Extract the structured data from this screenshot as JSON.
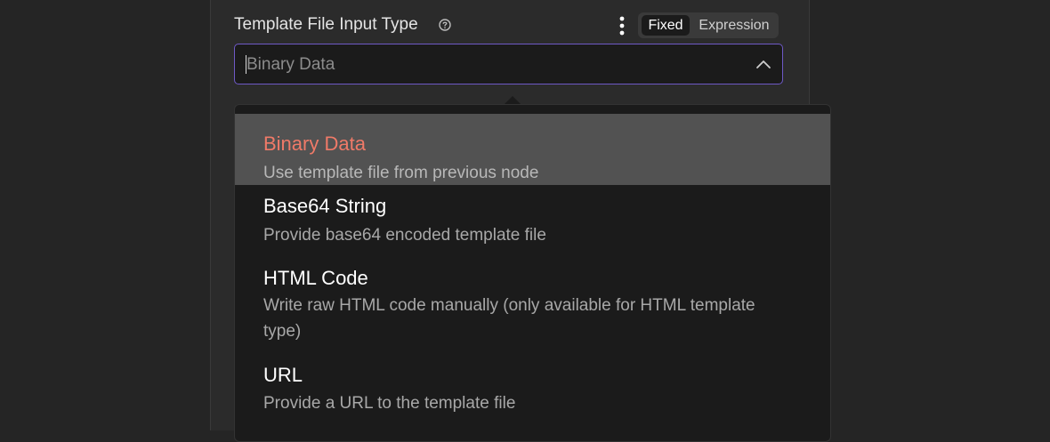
{
  "parameter": {
    "label": "Template File Input Type",
    "help_icon": "question-circle-icon",
    "options_icon": "kebab-menu-icon"
  },
  "mode_toggle": {
    "fixed_label": "Fixed",
    "expression_label": "Expression",
    "active": "Fixed"
  },
  "select": {
    "placeholder": "Binary Data",
    "chevron_icon": "chevron-up-icon"
  },
  "dropdown": {
    "items": [
      {
        "title": "Binary Data",
        "description": "Use template file from previous node",
        "selected": true
      },
      {
        "title": "Base64 String",
        "description": "Provide base64 encoded template file",
        "selected": false
      },
      {
        "title": "HTML Code",
        "description": "Write raw HTML code manually (only available for HTML template type)",
        "selected": false
      },
      {
        "title": "URL",
        "description": "Provide a URL to the template file",
        "selected": false
      }
    ]
  },
  "colors": {
    "accent_border": "#6e59c6",
    "selected_title": "#ef7a68",
    "selected_background": "#525252"
  }
}
